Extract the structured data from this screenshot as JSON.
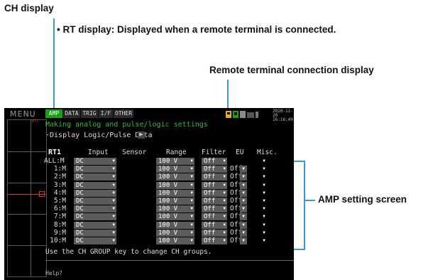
{
  "annotations": {
    "ch_display": "CH display",
    "rt_display": "• RT display: Displayed when a remote terminal is connected.",
    "remote_terminal": "Remote terminal connection display",
    "amp_setting": "AMP setting screen"
  },
  "screen": {
    "menu_label": "MENU",
    "tabs": [
      "AMP",
      "DATA",
      "TRIG",
      "I/F",
      "OTHER"
    ],
    "datetime_line1": "2020-11-20",
    "datetime_line2": "16:16:49",
    "title": "Making analog and pulse/logic settings",
    "subtitle": "·Display Logic/Pulse Data",
    "headers": {
      "rt": "RT1",
      "input": "Input",
      "sensor": "Sensor",
      "range": "Range",
      "filter": "Filter",
      "eu": "EU",
      "misc": "Misc."
    },
    "rows": [
      {
        "ch": "ALL:M",
        "input": "DC",
        "range": "100 V",
        "filter": "Off",
        "eu": ""
      },
      {
        "ch": "1:M",
        "input": "DC",
        "range": "100 V",
        "filter": "Off",
        "eu": "Off"
      },
      {
        "ch": "2:M",
        "input": "DC",
        "range": "100 V",
        "filter": "Off",
        "eu": "Off"
      },
      {
        "ch": "3:M",
        "input": "DC",
        "range": "100 V",
        "filter": "Off",
        "eu": "Off"
      },
      {
        "ch": "4:M",
        "input": "DC",
        "range": "100 V",
        "filter": "Off",
        "eu": "Off"
      },
      {
        "ch": "5:M",
        "input": "DC",
        "range": "100 V",
        "filter": "Off",
        "eu": "Off"
      },
      {
        "ch": "6:M",
        "input": "DC",
        "range": "100 V",
        "filter": "Off",
        "eu": "Off"
      },
      {
        "ch": "7:M",
        "input": "DC",
        "range": "100 V",
        "filter": "Off",
        "eu": "Off"
      },
      {
        "ch": "8:M",
        "input": "DC",
        "range": "100 V",
        "filter": "Off",
        "eu": "Off"
      },
      {
        "ch": "9:M",
        "input": "DC",
        "range": "100 V",
        "filter": "Off",
        "eu": "Off"
      },
      {
        "ch": "10:M",
        "input": "DC",
        "range": "100 V",
        "filter": "Off",
        "eu": "Off"
      }
    ],
    "hint": "Use the CH GROUP key to change CH groups.",
    "help": "Help?",
    "waveform_label": "RT1"
  },
  "colors": {
    "accent_green": "#18a018",
    "annotation_blue": "#3b98d6",
    "screen_bg": "#000000"
  }
}
